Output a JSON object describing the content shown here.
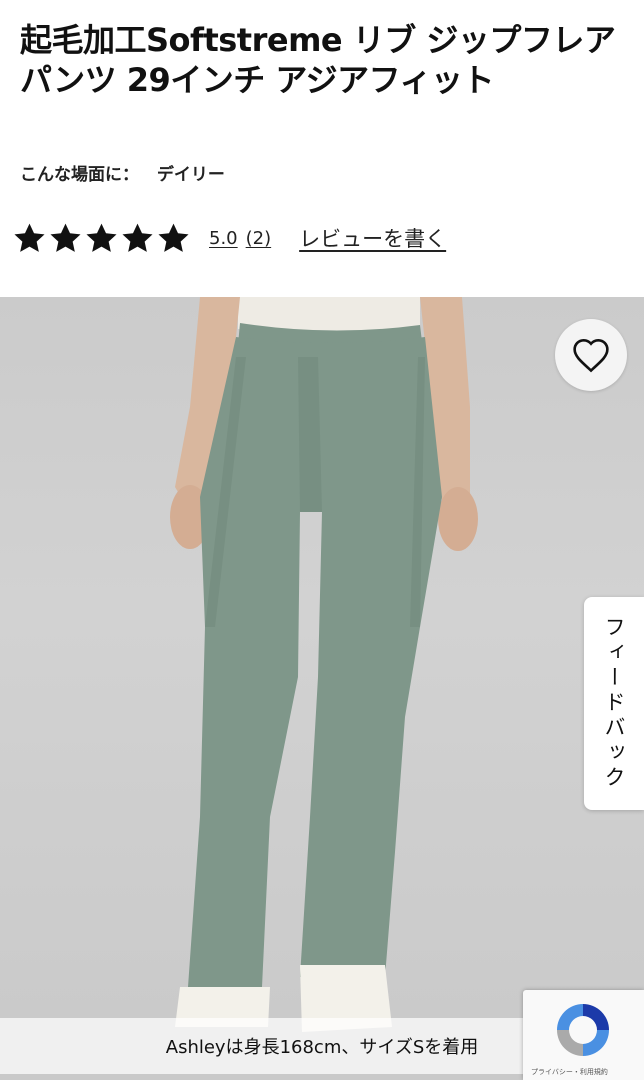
{
  "product": {
    "title": "起毛加工Softstreme リブ ジップフレアパンツ 29インチ アジアフィット",
    "activity_label": "こんな場面に：",
    "activity_value": "デイリー"
  },
  "rating": {
    "value": 5.0,
    "value_label": "5.0",
    "max": 5,
    "review_count_label": "(2)",
    "write_review_label": "レビューを書く"
  },
  "image": {
    "caption": "Ashleyは身長168cm、サイズSを着用",
    "icons": [
      "heart-icon"
    ]
  },
  "feedback_tab": {
    "label": "フィードバック"
  },
  "recaptcha": {
    "links": "プライバシー・利用規約"
  },
  "colors": {
    "pants": "#7f978a",
    "background": "#cbcbcb"
  }
}
